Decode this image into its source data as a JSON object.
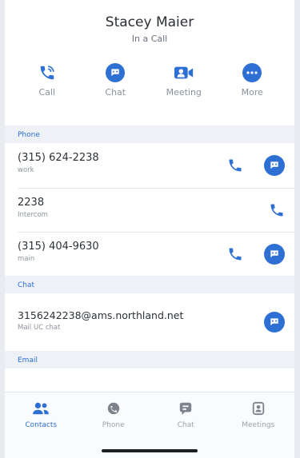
{
  "contact": {
    "name": "Stacey Maier",
    "status": "In a Call"
  },
  "actions": [
    {
      "label": "Call",
      "icon": "phone-call-icon"
    },
    {
      "label": "Chat",
      "icon": "chat-bubble-icon"
    },
    {
      "label": "Meeting",
      "icon": "video-camera-icon"
    },
    {
      "label": "More",
      "icon": "more-dots-icon"
    }
  ],
  "phone": {
    "header": "Phone",
    "entries": [
      {
        "number": "(315) 624-2238",
        "type": "work"
      },
      {
        "number": "2238",
        "type": "Intercom"
      },
      {
        "number": "(315) 404-9630",
        "type": "main"
      }
    ]
  },
  "chat": {
    "header": "Chat",
    "address": "3156242238@ams.northland.net",
    "type": "Mail UC chat"
  },
  "email": {
    "header": "Email"
  },
  "tabs": [
    {
      "label": "Contacts",
      "icon": "contacts-icon",
      "active": true
    },
    {
      "label": "Phone",
      "icon": "phone-tab-icon",
      "active": false
    },
    {
      "label": "Chat",
      "icon": "chat-tab-icon",
      "active": false
    },
    {
      "label": "Meetings",
      "icon": "meetings-tab-icon",
      "active": false
    }
  ],
  "colors": {
    "accent": "#2e6fd4",
    "section_bg": "#eef1f5"
  }
}
